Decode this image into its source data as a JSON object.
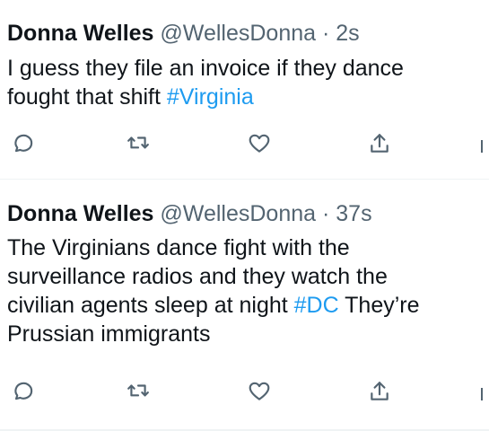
{
  "tweets": [
    {
      "display_name": "Donna Welles",
      "handle": "@WellesDonna",
      "separator": "·",
      "time": "2s",
      "lines": [
        [
          {
            "text": "I guess they file an invoice if they dance"
          }
        ],
        [
          {
            "text": "fought that shift "
          },
          {
            "hashtag": "#Virginia"
          }
        ]
      ]
    },
    {
      "display_name": "Donna Welles",
      "handle": "@WellesDonna",
      "separator": "·",
      "time": "37s",
      "lines": [
        [
          {
            "text": "The Virginians dance fight with the"
          }
        ],
        [
          {
            "text": "surveillance radios and they watch the"
          }
        ],
        [
          {
            "text": "civilian agents sleep at night "
          },
          {
            "hashtag": "#DC"
          },
          {
            "text": " They’re"
          }
        ],
        [
          {
            "text": "Prussian immigrants"
          }
        ]
      ]
    }
  ],
  "icons": {
    "reply": "reply-icon",
    "retweet": "retweet-icon",
    "like": "like-icon",
    "share": "share-icon",
    "analytics": "analytics-icon"
  },
  "colors": {
    "text": "#0f1419",
    "secondary": "#536471",
    "hashtag": "#1d9bf0",
    "divider": "#eff3f4",
    "background": "#ffffff"
  }
}
